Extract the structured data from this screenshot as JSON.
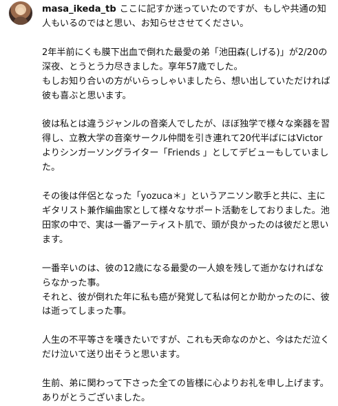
{
  "post": {
    "username": "masa_ikeda_tb",
    "caption_intro": "ここに記すか迷っていたのですが、もしや共通の知人もいるのではと思い、お知らせさせてください。",
    "paragraphs": [
      "2年半前にくも膜下出血で倒れた最愛の弟「池田森(しげる)」が2/20の深夜、とうとう力尽きました。享年57歳でした。\nもしお知り合いの方がいらっしゃいましたら、想い出していただければ彼も喜ぶと思います。",
      "彼は私とは違うジャンルの音楽人でしたが、ほぼ独学で様々な楽器を習得し、立教大学の音楽サークル仲間を引き連れて20代半ばにはVictorよりシンガーソングライター「Friends 」としてデビューもしていました。",
      "その後は伴侶となった「yozuca＊」というアニソン歌手と共に、主にギタリスト兼作編曲家として様々なサポート活動をしておりました。池田家の中で、実は一番アーティスト肌で、頭が良かったのは彼だと思います。",
      "一番辛いのは、彼の12歳になる最愛の一人娘を残して逝かなければならなかった事。\nそれと、彼が倒れた年に私も癌が発覚して私は何とか助かったのに、彼は逝ってしまった事。",
      "人生の不平等さを嘆きたいですが、これも天命なのかと、今はただ泣くだけ泣いて送り出そうと思います。",
      "生前、弟に関わって下さった全ての皆様に心よりお礼を申し上げます。ありがとうございました。"
    ]
  }
}
